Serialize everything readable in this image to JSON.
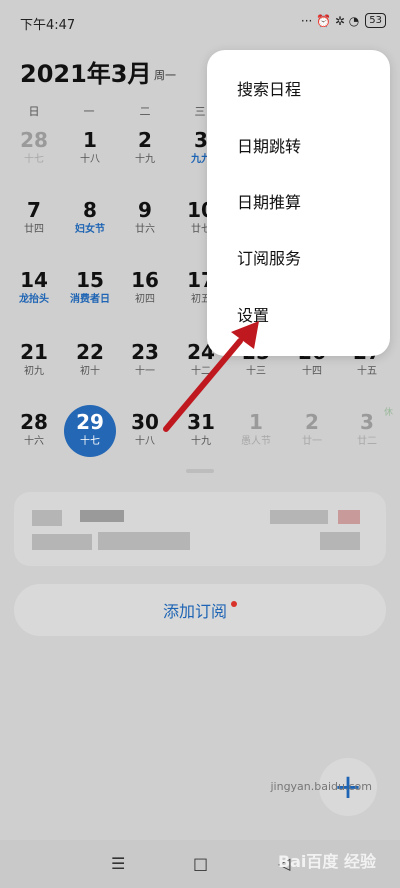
{
  "status_bar": {
    "time": "下午4:47",
    "icons": "··· ⏰ ✲ ◔",
    "battery": "53"
  },
  "calendar": {
    "title": "2021年3月",
    "weekday": "周一",
    "week_headers": [
      "日",
      "一",
      "二",
      "三",
      "四",
      "五",
      "六"
    ],
    "rows": [
      [
        {
          "num": "28",
          "sub": "十七",
          "type": "prev"
        },
        {
          "num": "1",
          "sub": "十八"
        },
        {
          "num": "2",
          "sub": "十九"
        },
        {
          "num": "3",
          "sub": "九九",
          "blue": true
        }
      ],
      [
        {
          "num": "7",
          "sub": "廿四"
        },
        {
          "num": "8",
          "sub": "妇女节",
          "blue": true
        },
        {
          "num": "9",
          "sub": "廿六"
        },
        {
          "num": "10",
          "sub": "廿七"
        }
      ],
      [
        {
          "num": "14",
          "sub": "龙抬头",
          "blue": true
        },
        {
          "num": "15",
          "sub": "消费者日",
          "blue": true
        },
        {
          "num": "16",
          "sub": "初四"
        },
        {
          "num": "17",
          "sub": "初五"
        }
      ],
      [
        {
          "num": "21",
          "sub": "初九"
        },
        {
          "num": "22",
          "sub": "初十"
        },
        {
          "num": "23",
          "sub": "十一"
        },
        {
          "num": "24",
          "sub": "十二"
        },
        {
          "num": "25",
          "sub": "十三"
        },
        {
          "num": "26",
          "sub": "十四"
        },
        {
          "num": "27",
          "sub": "十五"
        }
      ],
      [
        {
          "num": "28",
          "sub": "十六"
        },
        {
          "num": "29",
          "sub": "十七",
          "selected": true
        },
        {
          "num": "30",
          "sub": "十八"
        },
        {
          "num": "31",
          "sub": "十九"
        },
        {
          "num": "1",
          "sub": "愚人节",
          "type": "next"
        },
        {
          "num": "2",
          "sub": "廿一",
          "type": "next"
        },
        {
          "num": "3",
          "sub": "廿二",
          "type": "next",
          "tag": "休"
        }
      ]
    ]
  },
  "subscribe": {
    "label": "添加订阅"
  },
  "fab": {
    "label": "+"
  },
  "menu": {
    "items": [
      "搜索日程",
      "日期跳转",
      "日期推算",
      "订阅服务",
      "设置"
    ]
  },
  "nav": {
    "menu": "☰",
    "home": "□",
    "back": "◁"
  },
  "watermark": {
    "text": "Bai百度 经验",
    "url": "jingyan.baidu.com"
  },
  "colors": {
    "accent": "#1e64b4",
    "selected_circle": "#2467b4",
    "dimmed_bg": "#cfcfcf",
    "arrow": "#c0181f"
  }
}
